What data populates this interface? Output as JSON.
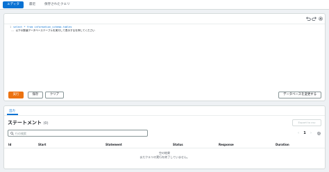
{
  "tabs": [
    {
      "label": "エディタ",
      "active": true
    },
    {
      "label": "最近",
      "active": false
    },
    {
      "label": "保存されたクエリ",
      "active": false
    }
  ],
  "editor": {
    "line_number": "1",
    "code_prefix": "select * from information_schema.tables",
    "comment": "-- 以下の数値データベーステーブルを実行して表示するを押してください"
  },
  "actions": {
    "run": "実行",
    "save": "保存",
    "clear": "クリア",
    "change_db": "データベースを変更する"
  },
  "results": {
    "tab_label": "出力",
    "title": "ステートメント",
    "count": "(0)",
    "export": "Export to csv",
    "search_placeholder": "行の検索",
    "page": "1",
    "columns": [
      "Id",
      "Start",
      "Statement",
      "Status",
      "Response",
      "Duration"
    ],
    "empty_title": "空の結果",
    "empty_sub": "まだクエリの実行を終了していません。"
  },
  "colors": {
    "primary": "#ec7211",
    "accent": "#0972d3"
  }
}
